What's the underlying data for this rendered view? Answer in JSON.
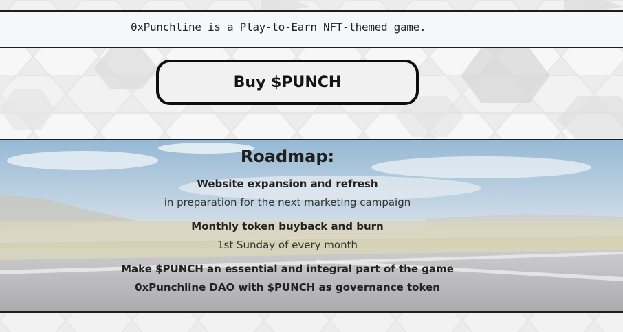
{
  "tagline": "0xPunchline is a Play-to-Earn NFT-themed game.",
  "buy_button": "Buy $PUNCH",
  "roadmap": {
    "title": "Roadmap:",
    "items": [
      {
        "heading": "Website expansion and refresh",
        "detail": "in preparation for the next marketing campaign"
      },
      {
        "heading": "Monthly token buyback and burn",
        "detail": "1st Sunday of every month"
      },
      {
        "heading": "Make $PUNCH an essential and integral part of the game",
        "detail": ""
      },
      {
        "heading": "0xPunchline DAO with $PUNCH as governance token",
        "detail": ""
      }
    ]
  },
  "colors": {
    "border": "#1e1e1e",
    "band_bg": "#f6f7f9",
    "hex_light": "#f4f4f4",
    "hex_dark": "#d9d9d9"
  }
}
